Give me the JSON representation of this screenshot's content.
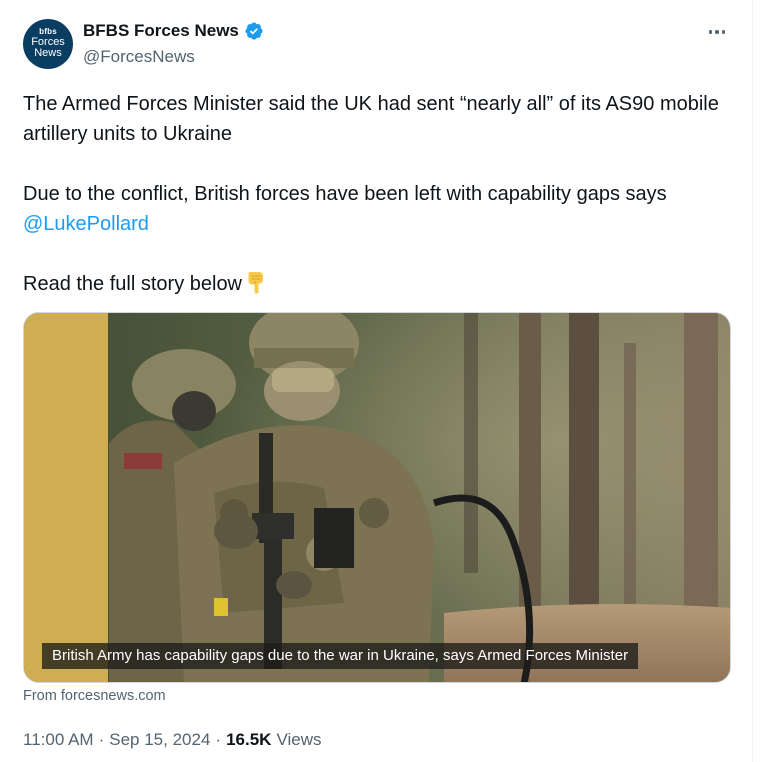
{
  "author": {
    "display_name": "BFBS Forces News",
    "handle": "@ForcesNews",
    "avatar_line1": "bfbs",
    "avatar_line2": "Forces",
    "avatar_line3": "News",
    "verified_icon": "verified-badge-icon"
  },
  "tweet": {
    "line1": "The Armed Forces Minister said the UK had sent “nearly all” of its AS90 mobile artillery units to Ukraine",
    "line2_prefix": "Due to the conflict, British forces have been left with capability gaps says ",
    "mention": "@LukePollard",
    "line3": "Read the full story below",
    "emoji": "pointing-down-hand-icon"
  },
  "media": {
    "caption": "British Army has capability gaps due to the war in Ukraine, says Armed Forces Minister",
    "source": "From forcesnews.com"
  },
  "meta": {
    "time": "11:00 AM",
    "sep1": "·",
    "date": "Sep 15, 2024",
    "sep2": "·",
    "views_count": "16.5K",
    "views_label": "Views"
  },
  "colors": {
    "link": "#1d9bf0",
    "secondary_text": "#536471",
    "verified": "#1d9bf0"
  }
}
